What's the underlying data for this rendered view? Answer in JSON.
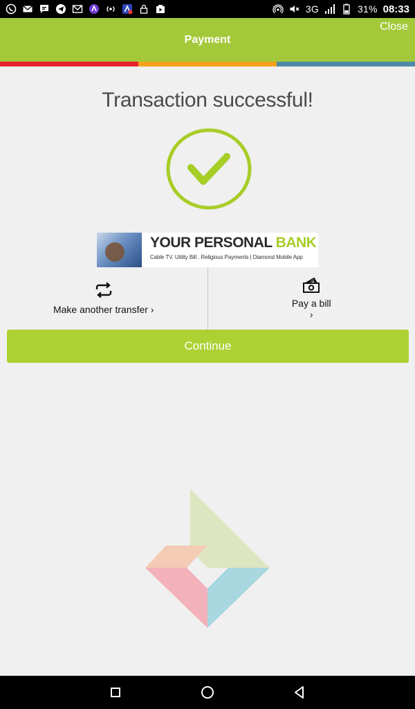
{
  "status_bar": {
    "battery": "31%",
    "time": "08:33",
    "network": "3G",
    "icons_left": [
      "whatsapp-icon",
      "mail-icon",
      "chat-icon",
      "telegram-icon",
      "gmail-icon",
      "app-icon",
      "radio-icon",
      "app-alert-icon",
      "lock-icon",
      "media-icon"
    ],
    "icons_right": [
      "hotspot-icon",
      "mute-icon",
      "signal-icon",
      "battery-icon"
    ]
  },
  "header": {
    "title": "Payment",
    "close_label": "Close",
    "bg_color": "#a3c93a",
    "stripe_colors": [
      "#e8222b",
      "#f5a21b",
      "#4e8aa8"
    ]
  },
  "main": {
    "title": "Transaction successful!",
    "check_color": "#a7cd27"
  },
  "banner": {
    "headline_dark": "YOUR PERSONAL",
    "headline_green": "BANK",
    "subline": "Cable TV. Utility Bill . Religious Payments | Diamond Mobile App"
  },
  "actions": {
    "transfer": {
      "label": "Make another transfer ›",
      "icon": "repeat-icon"
    },
    "bill": {
      "label": "Pay a bill ›",
      "icon": "cash-icon"
    }
  },
  "continue": {
    "label": "Continue",
    "color": "#add133"
  },
  "logo_colors": {
    "green": "#dde6c0",
    "peach": "#f4cbb4",
    "pink": "#f3b2bb",
    "blue": "#a9d7df"
  },
  "nav": {
    "recent": "square-icon",
    "home": "circle-icon",
    "back": "triangle-back-icon"
  }
}
